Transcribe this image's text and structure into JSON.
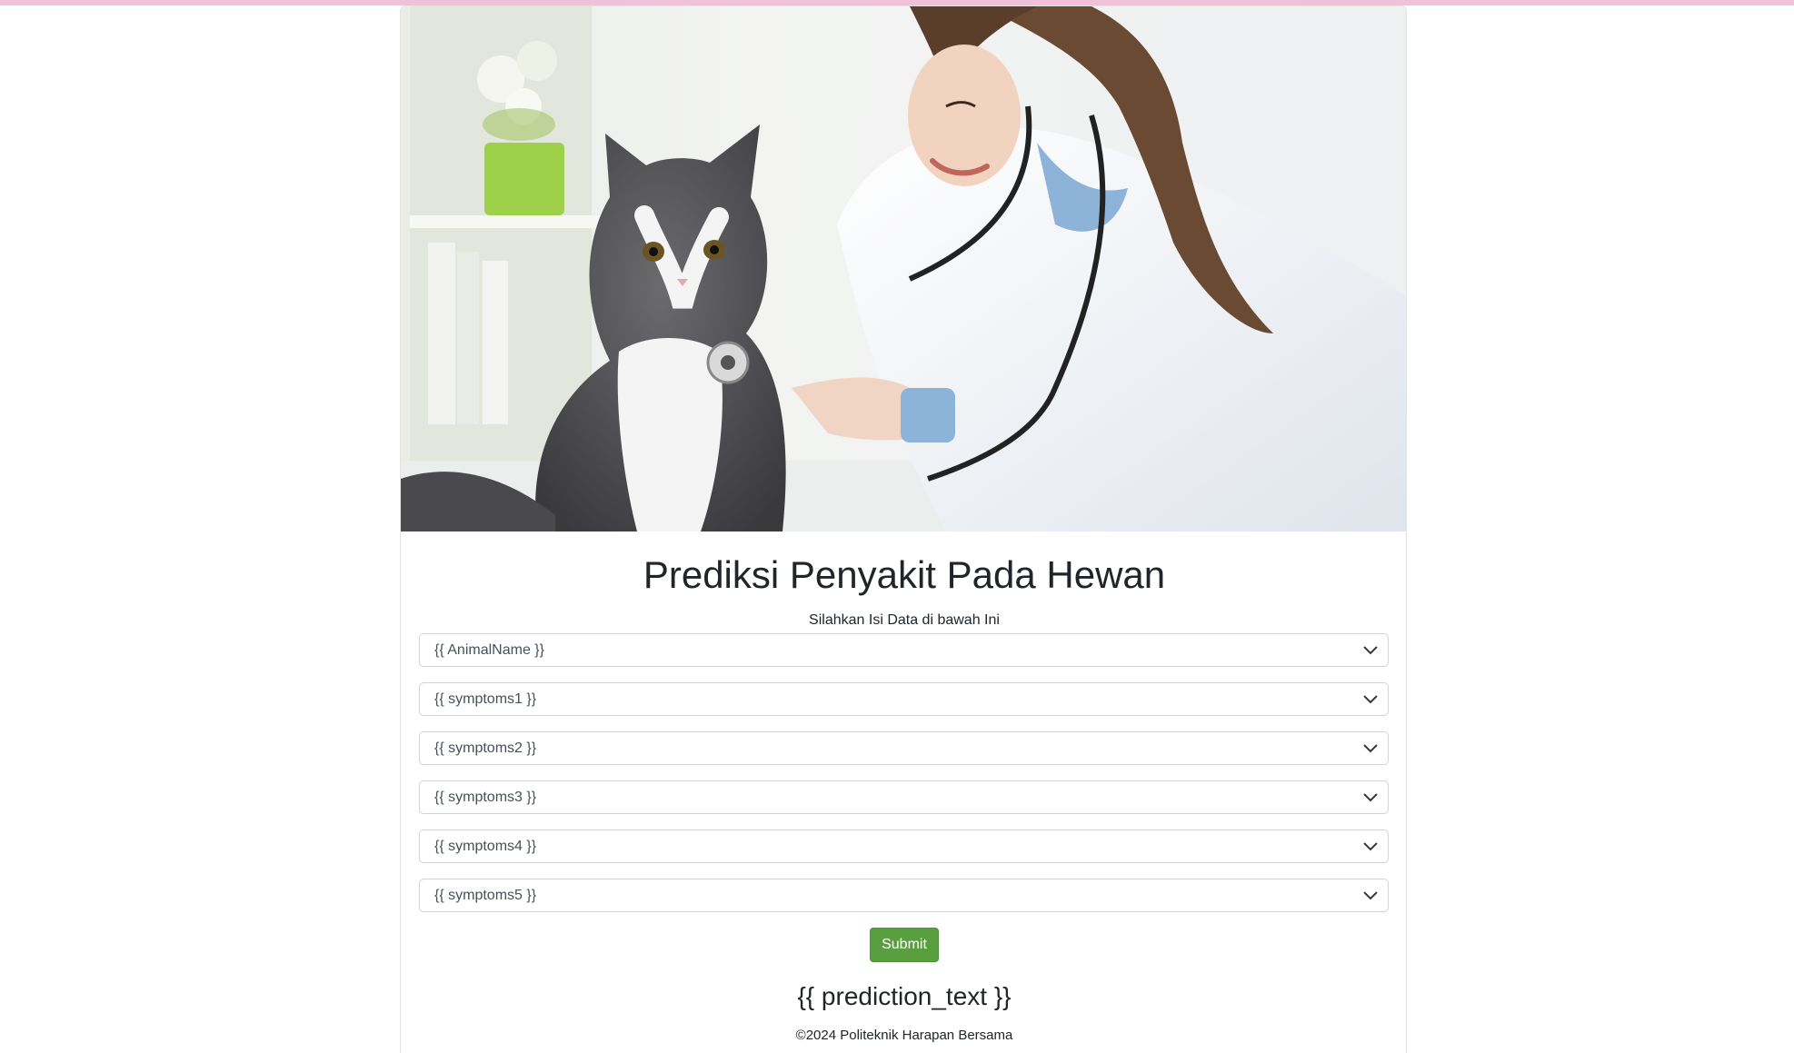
{
  "colors": {
    "top_bar": "#f2c1d9",
    "submit_button": "#5a9f3f",
    "text": "#212529"
  },
  "hero": {
    "image_subject": "veterinarian-examining-cat-with-stethoscope"
  },
  "header": {
    "title": "Prediksi Penyakit Pada Hewan",
    "subtitle": "Silahkan Isi Data di bawah Ini"
  },
  "form": {
    "selects": [
      {
        "value": "{{ AnimalName }}"
      },
      {
        "value": "{{ symptoms1 }}"
      },
      {
        "value": "{{ symptoms2 }}"
      },
      {
        "value": "{{ symptoms3 }}"
      },
      {
        "value": "{{ symptoms4 }}"
      },
      {
        "value": "{{ symptoms5 }}"
      }
    ],
    "submit_label": "Submit"
  },
  "result": {
    "prediction_text": "{{ prediction_text }}"
  },
  "footer": {
    "copyright": "©2024 Politeknik Harapan Bersama"
  }
}
